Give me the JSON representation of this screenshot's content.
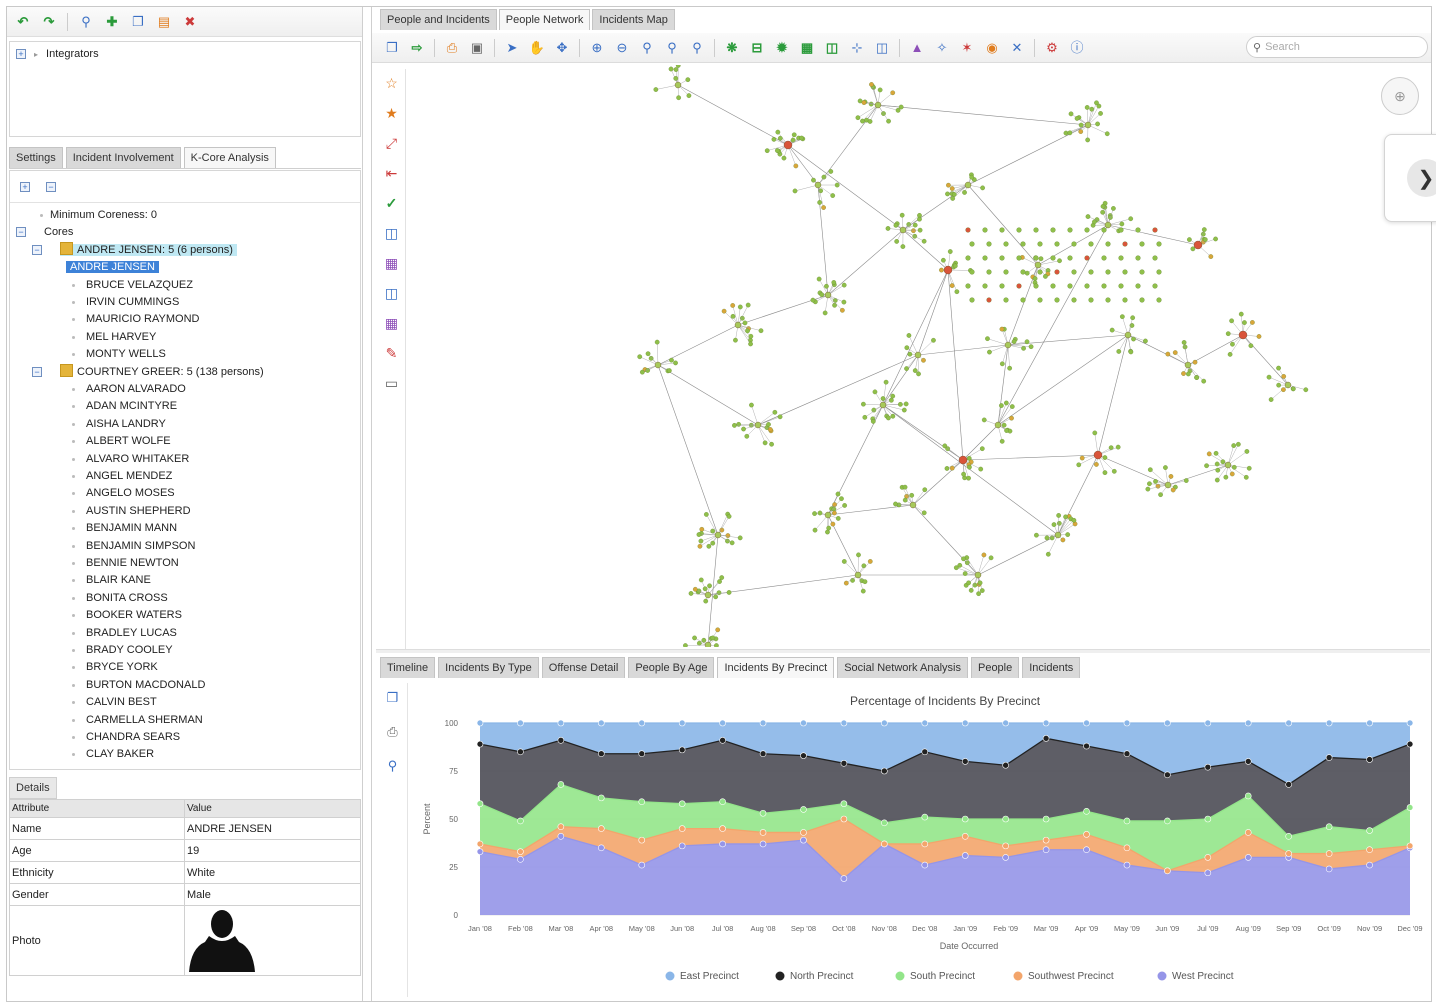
{
  "left_toolbar_icons": [
    "undo-icon",
    "redo-icon",
    "zoom-icon",
    "add-node-icon",
    "copy-icon",
    "export-icon",
    "delete-icon"
  ],
  "integrators": {
    "label": "Integrators"
  },
  "left_tabs": [
    "Settings",
    "Incident Involvement",
    "K-Core Analysis"
  ],
  "kcore": {
    "min_coreness": "Minimum Coreness: 0",
    "cores_label": "Cores",
    "groups": [
      {
        "label": "ANDRE JENSEN: 5 (6 persons)",
        "members": [
          "ANDRE JENSEN",
          "BRUCE VELAZQUEZ",
          "IRVIN CUMMINGS",
          "MAURICIO RAYMOND",
          "MEL HARVEY",
          "MONTY WELLS"
        ]
      },
      {
        "label": "COURTNEY GREER: 5 (138 persons)",
        "members": [
          "AARON ALVARADO",
          "ADAN MCINTYRE",
          "AISHA LANDRY",
          "ALBERT WOLFE",
          "ALVARO WHITAKER",
          "ANGEL MENDEZ",
          "ANGELO MOSES",
          "AUSTIN SHEPHERD",
          "BENJAMIN MANN",
          "BENJAMIN SIMPSON",
          "BENNIE NEWTON",
          "BLAIR KANE",
          "BONITA CROSS",
          "BOOKER WATERS",
          "BRADLEY LUCAS",
          "BRADY COOLEY",
          "BRYCE YORK",
          "BURTON MACDONALD",
          "CALVIN BEST",
          "CARMELLA SHERMAN",
          "CHANDRA SEARS",
          "CLAY BAKER"
        ]
      }
    ]
  },
  "details": {
    "tab": "Details",
    "header": {
      "attribute": "Attribute",
      "value": "Value"
    },
    "rows": [
      {
        "attribute": "Name",
        "value": "ANDRE JENSEN"
      },
      {
        "attribute": "Age",
        "value": "19"
      },
      {
        "attribute": "Ethnicity",
        "value": "White"
      },
      {
        "attribute": "Gender",
        "value": "Male"
      },
      {
        "attribute": "Photo",
        "value": ""
      }
    ]
  },
  "right_tabs": [
    "People and Incidents",
    "People Network",
    "Incidents Map"
  ],
  "active_right_tab": "People Network",
  "search": {
    "placeholder": "Search"
  },
  "bottom_tabs": [
    "Timeline",
    "Incidents By Type",
    "Offense Detail",
    "People By Age",
    "Incidents By Precinct",
    "Social Network Analysis",
    "People",
    "Incidents"
  ],
  "active_bottom_tab": "Incidents By Precinct",
  "colors": {
    "east": "#8ab6e8",
    "north": "#4d4d55",
    "south": "#93e58a",
    "southwest": "#f3a56b",
    "west": "#9595e8"
  },
  "chart_data": {
    "type": "area",
    "title": "Percentage of Incidents By Precinct",
    "xlabel": "Date Occurred",
    "ylabel": "Percent",
    "ylim": [
      0,
      100
    ],
    "yticks": [
      0,
      25,
      50,
      75,
      100
    ],
    "x": [
      "Jan '08",
      "Feb '08",
      "Mar '08",
      "Apr '08",
      "May '08",
      "Jun '08",
      "Jul '08",
      "Aug '08",
      "Sep '08",
      "Oct '08",
      "Nov '08",
      "Dec '08",
      "Jan '09",
      "Feb '09",
      "Mar '09",
      "Apr '09",
      "May '09",
      "Jun '09",
      "Jul '09",
      "Aug '09",
      "Sep '09",
      "Oct '09",
      "Nov '09",
      "Dec '09"
    ],
    "stacking": "percent",
    "legend_position": "bottom",
    "series": [
      {
        "name": "East Precinct",
        "color": "#8ab6e8",
        "values": [
          11,
          15,
          9,
          16,
          16,
          14,
          9,
          16,
          17,
          21,
          25,
          15,
          20,
          22,
          8,
          12,
          16,
          27,
          23,
          20,
          32,
          18,
          19,
          11
        ]
      },
      {
        "name": "North Precinct",
        "color": "#4d4d55",
        "values": [
          31,
          36,
          23,
          23,
          25,
          28,
          32,
          31,
          28,
          21,
          27,
          34,
          30,
          28,
          42,
          34,
          35,
          24,
          27,
          18,
          27,
          36,
          37,
          33
        ]
      },
      {
        "name": "South Precinct",
        "color": "#93e58a",
        "values": [
          21,
          16,
          22,
          16,
          20,
          13,
          14,
          10,
          12,
          8,
          11,
          14,
          9,
          14,
          11,
          12,
          14,
          26,
          20,
          19,
          9,
          14,
          10,
          20
        ]
      },
      {
        "name": "Southwest Precinct",
        "color": "#f3a56b",
        "values": [
          4,
          4,
          5,
          10,
          13,
          9,
          8,
          6,
          4,
          31,
          0,
          11,
          10,
          6,
          5,
          8,
          9,
          0,
          8,
          13,
          2,
          8,
          8,
          1
        ]
      },
      {
        "name": "West Precinct",
        "color": "#9595e8",
        "values": [
          33,
          29,
          41,
          35,
          26,
          36,
          37,
          37,
          39,
          19,
          37,
          26,
          31,
          30,
          34,
          34,
          26,
          23,
          22,
          30,
          30,
          24,
          26,
          35
        ]
      }
    ]
  }
}
